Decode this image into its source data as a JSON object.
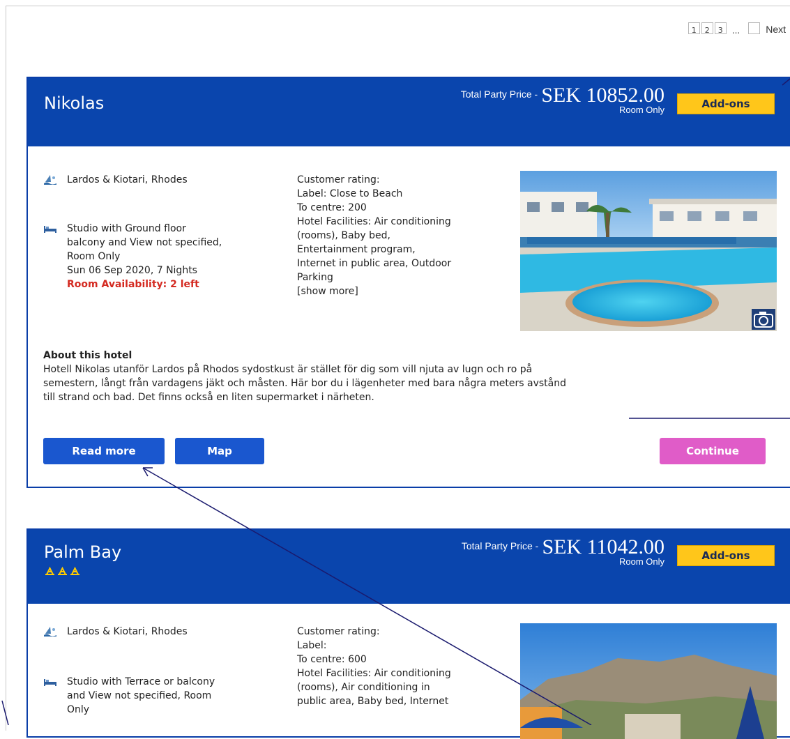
{
  "pagination": {
    "pages": [
      "1",
      "2",
      "3"
    ],
    "ellipsis": "...",
    "next_label": "Next"
  },
  "hotels": [
    {
      "name": "Nikolas",
      "price_label": "Total Party Price -",
      "price": "SEK 10852.00",
      "board": "Room Only",
      "addons_label": "Add-ons",
      "location": "Lardos & Kiotari, Rhodes",
      "room_lines": [
        "Studio with Ground floor",
        "balcony and View not specified,",
        "Room Only",
        "Sun 06 Sep 2020, 7 Nights"
      ],
      "availability": "Room Availability: 2 left",
      "details_lines": [
        "Customer rating:",
        "Label: Close to Beach",
        "To centre: 200",
        "Hotel Facilities: Air conditioning",
        "(rooms), Baby bed,",
        "Entertainment program,",
        "Internet in public area, Outdoor",
        "Parking"
      ],
      "show_more": "[show more]",
      "about_title": "About this hotel",
      "about_lines": [
        "Hotell Nikolas utanför Lardos på Rhodos sydostkust är stället för dig som vill njuta av lugn och ro på",
        "semestern, långt från vardagens jäkt och måsten. Här bor du i lägenheter med bara några meters avstånd",
        "till strand och bad. Det finns också en liten supermarket i närheten."
      ],
      "read_more_label": "Read more",
      "map_label": "Map",
      "continue_label": "Continue"
    },
    {
      "name": "Palm Bay",
      "price_label": "Total Party Price -",
      "price": "SEK 11042.00",
      "board": "Room Only",
      "addons_label": "Add-ons",
      "location": "Lardos & Kiotari, Rhodes",
      "room_lines": [
        "Studio with Terrace or balcony",
        "and View not specified, Room",
        "Only"
      ],
      "details_lines": [
        "Customer rating:",
        "Label:",
        "To centre: 600",
        "Hotel Facilities: Air conditioning",
        "(rooms), Air conditioning in",
        "public area, Baby bed, Internet"
      ]
    }
  ],
  "colors": {
    "header_blue": "#0a45ad",
    "addons_yellow": "#ffc61a",
    "button_blue": "#1a57cf",
    "continue_pink": "#e05cc8",
    "availability_red": "#d42a21",
    "annotation_line": "#1a1a6e"
  },
  "icons": {
    "location": "beach-icon",
    "room": "bed-icon",
    "camera": "camera-icon",
    "rating": "sun-star-icon"
  }
}
